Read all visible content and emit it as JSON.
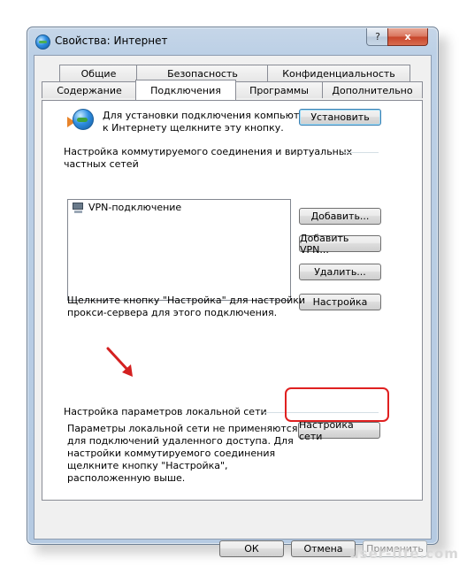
{
  "window": {
    "title": "Свойства: Интернет",
    "help_label": "?",
    "close_label": "x"
  },
  "tabs": {
    "row1": [
      "Общие",
      "Безопасность",
      "Конфиденциальность"
    ],
    "row2": [
      "Содержание",
      "Подключения",
      "Программы",
      "Дополнительно"
    ],
    "active": "Подключения"
  },
  "setup": {
    "text_line1": "Для установки подключения компьютера",
    "text_line2": "к Интернету щелкните эту кнопку.",
    "button": "Установить"
  },
  "dialup": {
    "header_line1": "Настройка коммутируемого соединения и виртуальных",
    "header_line2": "частных сетей",
    "items": [
      "VPN-подключение"
    ],
    "add_button": "Добавить...",
    "add_vpn_button": "Добавить VPN...",
    "remove_button": "Удалить...",
    "settings_button": "Настройка",
    "proxy_text_line1": "Щелкните кнопку \"Настройка\" для настройки",
    "proxy_text_line2": "прокси-сервера для этого подключения."
  },
  "lan": {
    "header": "Настройка параметров локальной сети",
    "text_line1": "Параметры локальной сети не применяются",
    "text_line2": "для подключений удаленного доступа. Для",
    "text_line3": "настройки коммутируемого соединения",
    "text_line4": "щелкните кнопку \"Настройка\",",
    "text_line5": "расположенную выше.",
    "button": "Настройка сети"
  },
  "footer": {
    "ok": "ОК",
    "cancel": "Отмена",
    "apply": "Применить"
  },
  "watermark": "user-life.com",
  "colors": {
    "highlight": "#e02020",
    "arrow": "#d42020"
  }
}
